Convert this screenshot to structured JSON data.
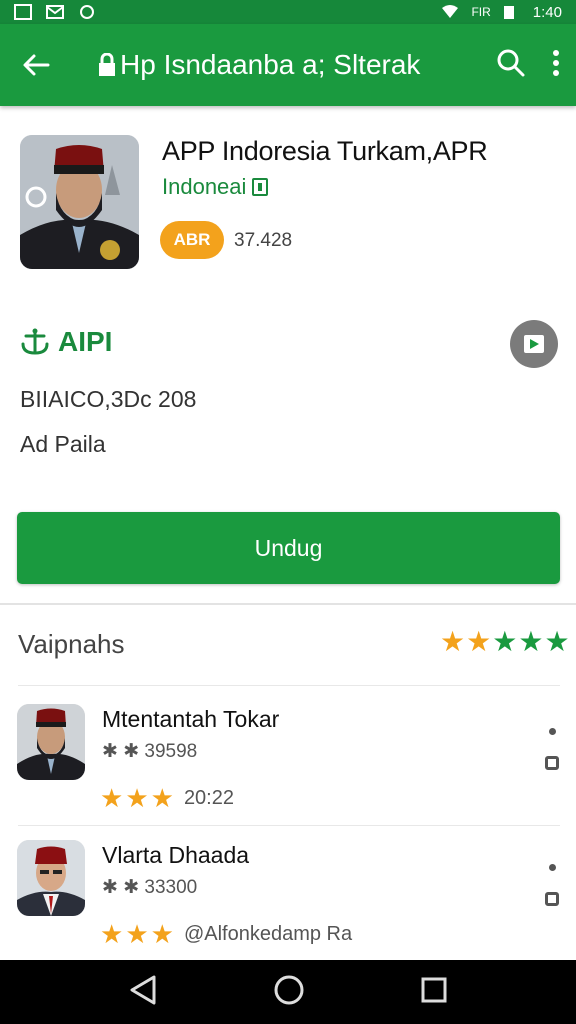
{
  "status_bar": {
    "time": "1:40",
    "right_text": "FIR"
  },
  "toolbar": {
    "title": "Hp Isndaanba a; Slterak"
  },
  "app": {
    "name": "APP Indoresia Turkam,APR",
    "developer": "Indoneai",
    "rating_badge": "ABR",
    "rating_count": "37.428"
  },
  "info": {
    "label": "AIPI",
    "line1": "BIIAICO,3Dc 208",
    "line2": "Ad Paila"
  },
  "install": {
    "label": "Undug"
  },
  "reviews": {
    "title": "Vaipnahs",
    "rating_stars": 5,
    "items": [
      {
        "name": "Mtentantah Tokar",
        "meta": "✱ ✱ 39598",
        "stars_filled": 3,
        "date": "20:22"
      },
      {
        "name": "Vlarta Dhaada",
        "meta": "✱ ✱ 33300",
        "stars_filled": 3,
        "date": "@Alfonkedamp Ra"
      }
    ]
  },
  "colors": {
    "primary_green": "#1a9a3f",
    "accent_orange": "#f3a21c"
  },
  "icons": [
    "back-arrow-icon",
    "search-icon",
    "more-vertical-icon",
    "play-icon",
    "nav-back-icon",
    "nav-home-icon",
    "nav-recents-icon"
  ]
}
